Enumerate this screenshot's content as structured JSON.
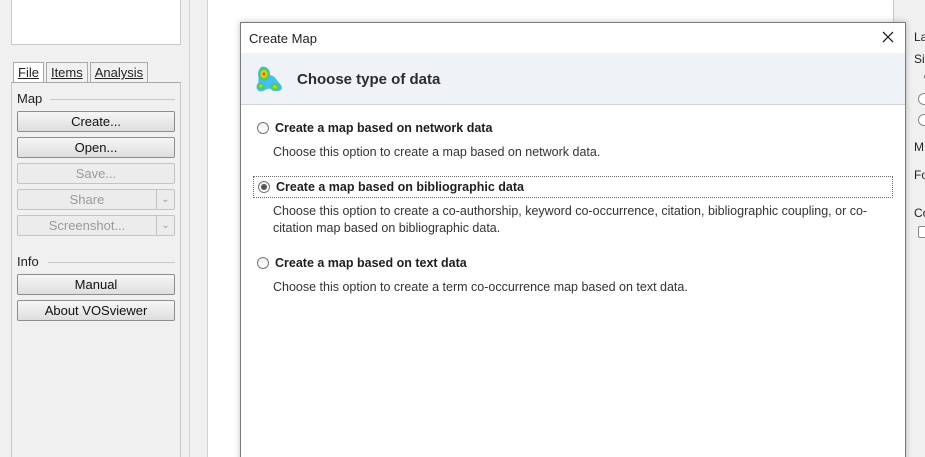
{
  "sidebar": {
    "tabs": [
      {
        "label": "File",
        "active": true
      },
      {
        "label": "Items",
        "active": false
      },
      {
        "label": "Analysis",
        "active": false
      }
    ],
    "map_group_label": "Map",
    "map_buttons": {
      "create": "Create...",
      "open": "Open...",
      "save": "Save...",
      "share": "Share",
      "screenshot": "Screenshot..."
    },
    "info_group_label": "Info",
    "info_buttons": {
      "manual": "Manual",
      "about": "About VOSviewer"
    }
  },
  "dialog": {
    "title": "Create Map",
    "close_icon": "close-icon",
    "header_icon": "vosviewer-density-icon",
    "header_title": "Choose type of data",
    "selected_option": "bibliographic",
    "options": [
      {
        "id": "network",
        "label": "Create a map based on network data",
        "description": "Choose this option to create a map based on network data.",
        "checked": false
      },
      {
        "id": "bibliographic",
        "label": "Create a map based on bibliographic data",
        "description": "Choose this option to create a co-authorship, keyword co-occurrence, citation, bibliographic coupling, or co-citation map based on bibliographic data.",
        "checked": true
      },
      {
        "id": "text",
        "label": "Create a map based on text data",
        "description": "Choose this option to create a term co-occurrence map based on text data.",
        "checked": false
      }
    ]
  },
  "right_panel": {
    "fragments": [
      "La",
      "Si",
      "c",
      "M",
      "Fo",
      "Co"
    ]
  },
  "colors": {
    "dialog_header_bg": "#eff2f7",
    "panel_bg": "#f0f0f0"
  }
}
